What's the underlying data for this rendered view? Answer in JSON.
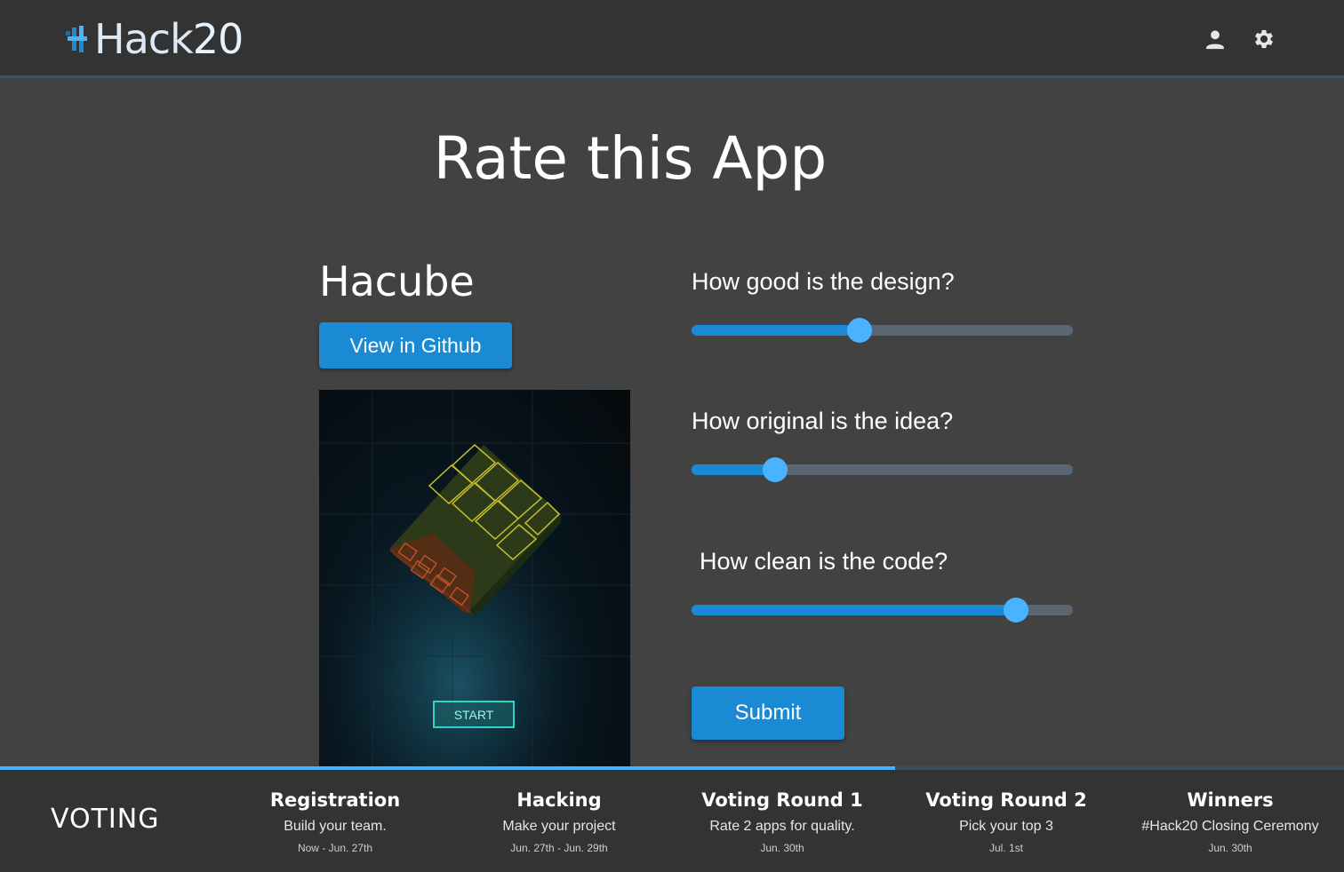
{
  "header": {
    "logo_text": "Hack",
    "logo_number": "20",
    "account_icon": "account-icon",
    "settings_icon": "gear-icon"
  },
  "main": {
    "title": "Rate this App"
  },
  "app": {
    "name": "Hacube",
    "github_label": "View in Github",
    "screenshot_start_label": "START"
  },
  "rating": {
    "questions": [
      {
        "label": "How good is the design?",
        "value": 0.44
      },
      {
        "label": "How original is the idea?",
        "value": 0.22
      },
      {
        "label": "How clean is the code?",
        "value": 0.85
      }
    ],
    "submit_label": "Submit"
  },
  "timeline": {
    "current_phase": "VOTING",
    "progress": 0.666,
    "stages": [
      {
        "title": "Registration",
        "desc": "Build your team.",
        "date": "Now - Jun. 27th"
      },
      {
        "title": "Hacking",
        "desc": "Make your project",
        "date": "Jun. 27th - Jun. 29th"
      },
      {
        "title": "Voting Round 1",
        "desc": "Rate 2 apps for quality.",
        "date": "Jun. 30th"
      },
      {
        "title": "Voting Round 2",
        "desc": "Pick your top 3",
        "date": "Jul. 1st"
      },
      {
        "title": "Winners",
        "desc": "#Hack20 Closing Ceremony",
        "date": "Jun. 30th"
      }
    ]
  },
  "colors": {
    "background": "#424242",
    "header": "#333333",
    "accent": "#1a8ad4",
    "thumb": "#4ab3ff",
    "track": "#5b6673"
  }
}
